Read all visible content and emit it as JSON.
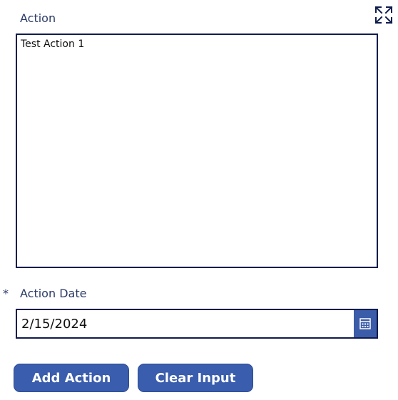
{
  "form": {
    "action_label": "Action",
    "action_value": "Test Action 1",
    "required_marker": "*",
    "date_label": "Action Date",
    "date_value": "2/15/2024"
  },
  "buttons": {
    "add_label": "Add Action",
    "clear_label": "Clear Input"
  },
  "icons": {
    "expand": "expand-icon",
    "calendar": "calendar-icon"
  },
  "colors": {
    "label": "#2b3a67",
    "border": "#0f1c4d",
    "button": "#3a5dad",
    "calendar_button": "#3b5ca8"
  }
}
